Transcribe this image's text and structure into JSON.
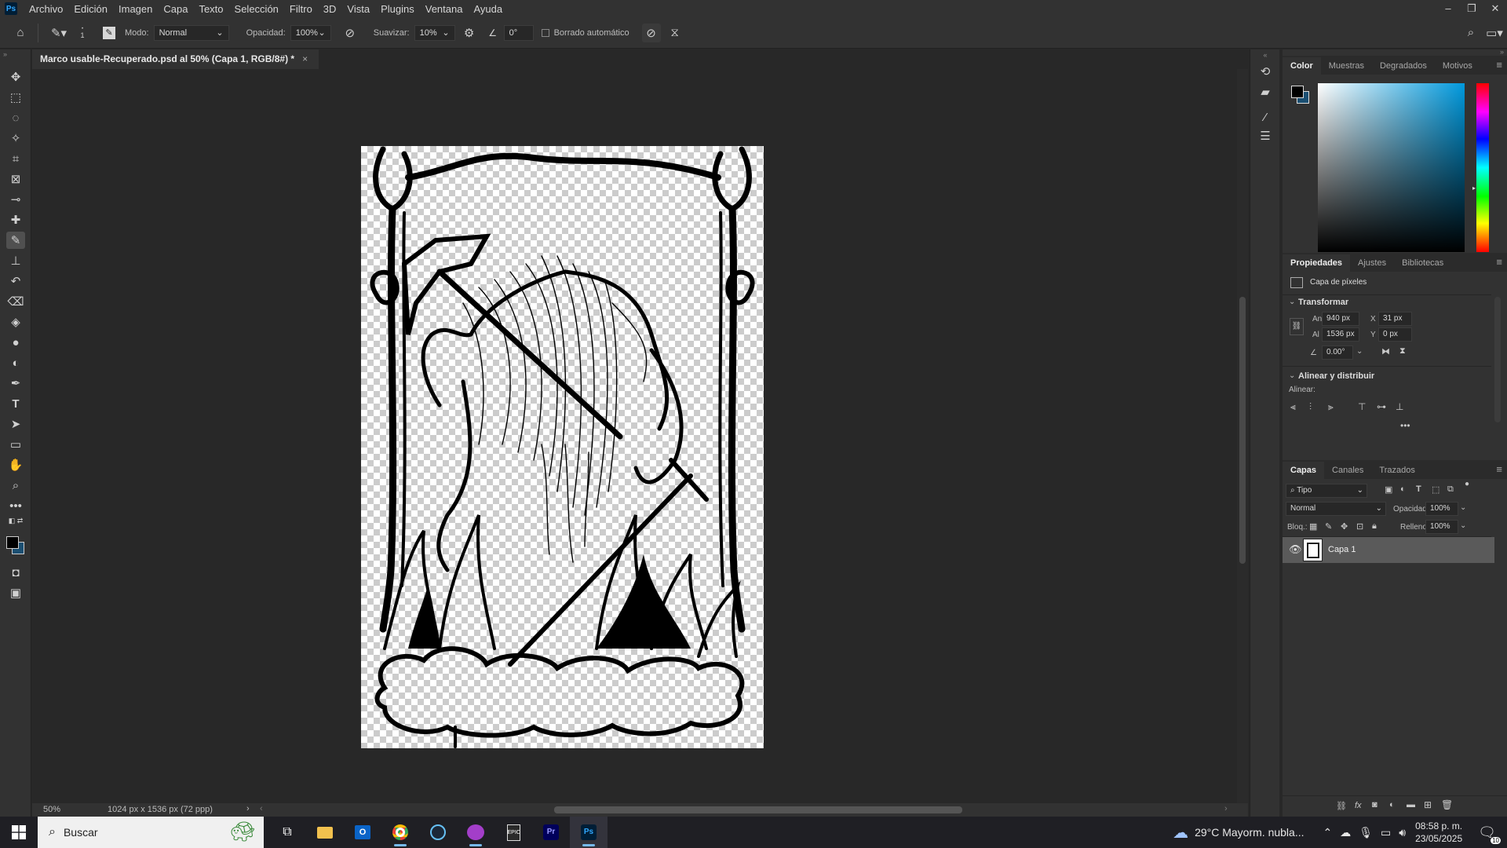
{
  "menu": [
    "Archivo",
    "Edición",
    "Imagen",
    "Capa",
    "Texto",
    "Selección",
    "Filtro",
    "3D",
    "Vista",
    "Plugins",
    "Ventana",
    "Ayuda"
  ],
  "app_logo": "Ps",
  "options": {
    "brush_size": "1",
    "mode_label": "Modo:",
    "mode_value": "Normal",
    "opacity_label": "Opacidad:",
    "opacity_value": "100%",
    "smooth_label": "Suavizar:",
    "smooth_value": "10%",
    "angle_value": "0°",
    "auto_erase_label": "Borrado automático"
  },
  "document": {
    "tab_title": "Marco usable-Recuperado.psd al 50% (Capa 1, RGB/8#) *",
    "zoom": "50%",
    "dims": "1024 px x 1536 px (72 ppp)"
  },
  "color_panel": {
    "tabs": [
      "Color",
      "Muestras",
      "Degradados",
      "Motivos"
    ],
    "foreground": "#000000",
    "background": "#1b4f72"
  },
  "properties": {
    "tabs": [
      "Propiedades",
      "Ajustes",
      "Bibliotecas"
    ],
    "layer_type": "Capa de píxeles",
    "transform_title": "Transformar",
    "w_label": "An",
    "w_value": "940 px",
    "h_label": "Al",
    "h_value": "1536 px",
    "x_label": "X",
    "x_value": "31 px",
    "y_label": "Y",
    "y_value": "0 px",
    "angle_value": "0.00°",
    "align_title": "Alinear y distribuir",
    "align_label": "Alinear:"
  },
  "layers": {
    "tabs": [
      "Capas",
      "Canales",
      "Trazados"
    ],
    "filter_value": "Tipo",
    "blend_value": "Normal",
    "opacity_label": "Opacidad:",
    "opacity_value": "100%",
    "lock_label": "Bloq.:",
    "fill_label": "Relleno:",
    "fill_value": "100%",
    "items": [
      {
        "name": "Capa 1",
        "visible": true
      }
    ]
  },
  "taskbar": {
    "search_placeholder": "Buscar",
    "weather": "29°C  Mayorm. nubla...",
    "time": "08:58 p. m.",
    "date": "23/05/2025",
    "notif_count": "10"
  }
}
